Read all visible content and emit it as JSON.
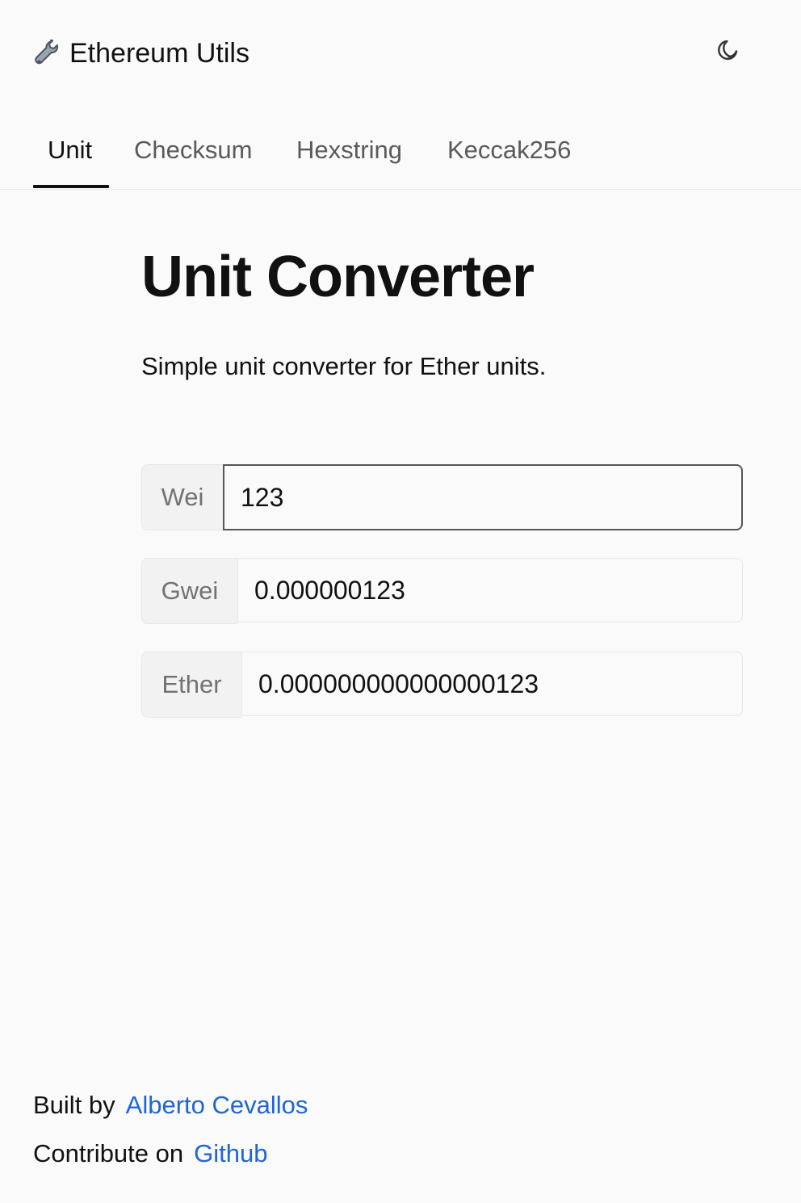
{
  "header": {
    "app_icon": "wrench-icon",
    "app_title": "Ethereum Utils",
    "theme_toggle_icon": "moon-icon"
  },
  "tabs": [
    {
      "label": "Unit",
      "active": true
    },
    {
      "label": "Checksum",
      "active": false
    },
    {
      "label": "Hexstring",
      "active": false
    },
    {
      "label": "Keccak256",
      "active": false
    }
  ],
  "main": {
    "title": "Unit Converter",
    "description": "Simple unit converter for Ether units.",
    "fields": [
      {
        "unit": "Wei",
        "value": "123",
        "focused": true
      },
      {
        "unit": "Gwei",
        "value": "0.000000123",
        "focused": false
      },
      {
        "unit": "Ether",
        "value": "0.000000000000000123",
        "focused": false
      }
    ]
  },
  "footer": {
    "built_by_text": "Built by",
    "author_name": "Alberto Cevallos",
    "contribute_text": "Contribute on",
    "github_text": "Github"
  },
  "colors": {
    "background": "#fafafa",
    "text": "#111111",
    "muted_text": "#727272",
    "link": "#1f64d8",
    "focused_border": "#555555",
    "field_border": "#e7e7e7"
  }
}
